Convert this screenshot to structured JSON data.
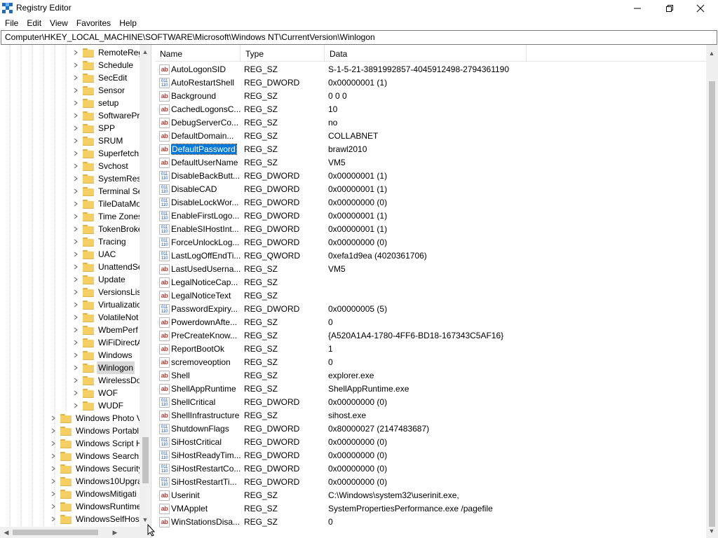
{
  "window": {
    "title": "Registry Editor",
    "controls": {
      "minimize": "—",
      "maximize": "☐",
      "close": "✕"
    }
  },
  "menu": [
    "File",
    "Edit",
    "View",
    "Favorites",
    "Help"
  ],
  "address": "Computer\\HKEY_LOCAL_MACHINE\\SOFTWARE\\Microsoft\\Windows NT\\CurrentVersion\\Winlogon",
  "tree": {
    "children": [
      "RemoteRegistry",
      "Schedule",
      "SecEdit",
      "Sensor",
      "setup",
      "SoftwareProtectionPlatform",
      "SPP",
      "SRUM",
      "Superfetch",
      "Svchost",
      "SystemRestore",
      "Terminal Server",
      "TileDataModel",
      "Time Zones",
      "TokenBroker",
      "Tracing",
      "UAC",
      "UnattendSettings",
      "Update",
      "VersionsList",
      "Virtualization",
      "VolatileNotifications",
      "WbemPerf",
      "WiFiDirectAPI",
      "Windows",
      "Winlogon",
      "WirelessDocking",
      "WOF",
      "WUDF"
    ],
    "children_display": [
      "RemoteReg",
      "Schedule",
      "SecEdit",
      "Sensor",
      "setup",
      "SoftwarePr",
      "SPP",
      "SRUM",
      "Superfetch",
      "Svchost",
      "SystemRest",
      "Terminal Se",
      "TileDataMo",
      "Time Zones",
      "TokenBroke",
      "Tracing",
      "UAC",
      "UnattendSe",
      "Update",
      "VersionsList",
      "Virtualizatic",
      "VolatileNot",
      "WbemPerf",
      "WiFiDirectA",
      "Windows",
      "Winlogon",
      "WirelessDo",
      "WOF",
      "WUDF"
    ],
    "selected": "Winlogon",
    "siblings_display": [
      "Windows Photo V",
      "Windows Portabl",
      "Windows Script H",
      "Windows Search",
      "Windows Security",
      "Windows10Upgra",
      "WindowsMitigati",
      "WindowsRuntime",
      "WindowsSelfHost"
    ]
  },
  "columns": {
    "name": "Name",
    "type": "Type",
    "data": "Data"
  },
  "values": [
    {
      "name": "AutoLogonSID",
      "type": "REG_SZ",
      "data": "S-1-5-21-3891992857-4045912498-2794361190",
      "kind": "sz"
    },
    {
      "name": "AutoRestartShell",
      "type": "REG_DWORD",
      "data": "0x00000001 (1)",
      "kind": "dw"
    },
    {
      "name": "Background",
      "type": "REG_SZ",
      "data": "0 0 0",
      "kind": "sz"
    },
    {
      "name": "CachedLogonsC...",
      "type": "REG_SZ",
      "data": "10",
      "kind": "sz"
    },
    {
      "name": "DebugServerCo...",
      "type": "REG_SZ",
      "data": "no",
      "kind": "sz"
    },
    {
      "name": "DefaultDomain...",
      "type": "REG_SZ",
      "data": "COLLABNET",
      "kind": "sz"
    },
    {
      "name": "DefaultPassword",
      "type": "REG_SZ",
      "data": "brawl2010",
      "kind": "sz",
      "selected": true
    },
    {
      "name": "DefaultUserName",
      "type": "REG_SZ",
      "data": "VM5",
      "kind": "sz"
    },
    {
      "name": "DisableBackButt...",
      "type": "REG_DWORD",
      "data": "0x00000001 (1)",
      "kind": "dw"
    },
    {
      "name": "DisableCAD",
      "type": "REG_DWORD",
      "data": "0x00000001 (1)",
      "kind": "dw"
    },
    {
      "name": "DisableLockWor...",
      "type": "REG_DWORD",
      "data": "0x00000000 (0)",
      "kind": "dw"
    },
    {
      "name": "EnableFirstLogo...",
      "type": "REG_DWORD",
      "data": "0x00000001 (1)",
      "kind": "dw"
    },
    {
      "name": "EnableSIHostInt...",
      "type": "REG_DWORD",
      "data": "0x00000001 (1)",
      "kind": "dw"
    },
    {
      "name": "ForceUnlockLog...",
      "type": "REG_DWORD",
      "data": "0x00000000 (0)",
      "kind": "dw"
    },
    {
      "name": "LastLogOffEndTi...",
      "type": "REG_QWORD",
      "data": "0xefa1d9ea (4020361706)",
      "kind": "dw"
    },
    {
      "name": "LastUsedUserna...",
      "type": "REG_SZ",
      "data": "VM5",
      "kind": "sz"
    },
    {
      "name": "LegalNoticeCap...",
      "type": "REG_SZ",
      "data": "",
      "kind": "sz"
    },
    {
      "name": "LegalNoticeText",
      "type": "REG_SZ",
      "data": "",
      "kind": "sz"
    },
    {
      "name": "PasswordExpiry...",
      "type": "REG_DWORD",
      "data": "0x00000005 (5)",
      "kind": "dw"
    },
    {
      "name": "PowerdownAfte...",
      "type": "REG_SZ",
      "data": "0",
      "kind": "sz"
    },
    {
      "name": "PreCreateKnow...",
      "type": "REG_SZ",
      "data": "{A520A1A4-1780-4FF6-BD18-167343C5AF16}",
      "kind": "sz"
    },
    {
      "name": "ReportBootOk",
      "type": "REG_SZ",
      "data": "1",
      "kind": "sz"
    },
    {
      "name": "scremoveoption",
      "type": "REG_SZ",
      "data": "0",
      "kind": "sz"
    },
    {
      "name": "Shell",
      "type": "REG_SZ",
      "data": "explorer.exe",
      "kind": "sz"
    },
    {
      "name": "ShellAppRuntime",
      "type": "REG_SZ",
      "data": "ShellAppRuntime.exe",
      "kind": "sz"
    },
    {
      "name": "ShellCritical",
      "type": "REG_DWORD",
      "data": "0x00000000 (0)",
      "kind": "dw"
    },
    {
      "name": "ShellInfrastructure",
      "type": "REG_SZ",
      "data": "sihost.exe",
      "kind": "sz"
    },
    {
      "name": "ShutdownFlags",
      "type": "REG_DWORD",
      "data": "0x80000027 (2147483687)",
      "kind": "dw"
    },
    {
      "name": "SiHostCritical",
      "type": "REG_DWORD",
      "data": "0x00000000 (0)",
      "kind": "dw"
    },
    {
      "name": "SiHostReadyTim...",
      "type": "REG_DWORD",
      "data": "0x00000000 (0)",
      "kind": "dw"
    },
    {
      "name": "SiHostRestartCo...",
      "type": "REG_DWORD",
      "data": "0x00000000 (0)",
      "kind": "dw"
    },
    {
      "name": "SiHostRestartTi...",
      "type": "REG_DWORD",
      "data": "0x00000000 (0)",
      "kind": "dw"
    },
    {
      "name": "Userinit",
      "type": "REG_SZ",
      "data": "C:\\Windows\\system32\\userinit.exe,",
      "kind": "sz"
    },
    {
      "name": "VMApplet",
      "type": "REG_SZ",
      "data": "SystemPropertiesPerformance.exe /pagefile",
      "kind": "sz"
    },
    {
      "name": "WinStationsDisa...",
      "type": "REG_SZ",
      "data": "0",
      "kind": "sz"
    }
  ],
  "icons": {
    "string_value": "ab",
    "binary_value": "011 110"
  }
}
